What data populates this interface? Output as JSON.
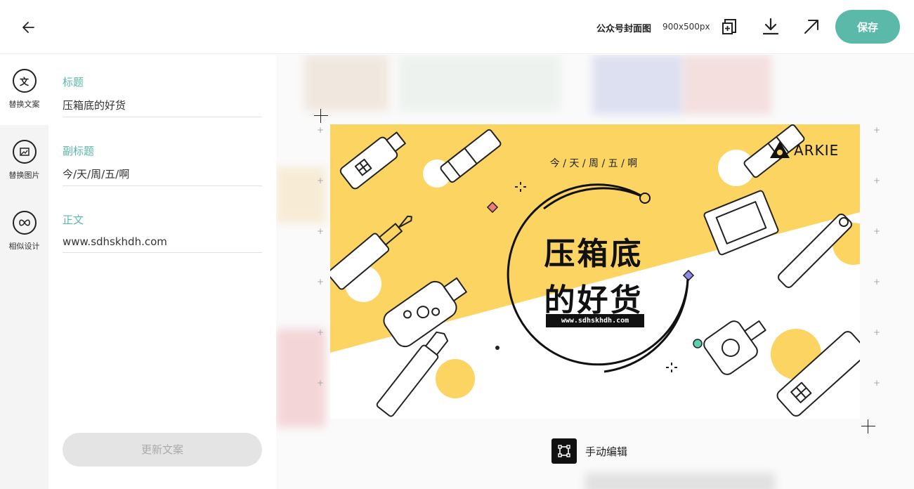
{
  "header": {
    "doc_title": "公众号封面图",
    "doc_size": "900x500px",
    "save_label": "保存"
  },
  "rail": {
    "items": [
      {
        "icon_text": "文",
        "label": "替换文案"
      },
      {
        "label": "替换图片"
      },
      {
        "label": "相似设计"
      }
    ]
  },
  "form": {
    "fields": [
      {
        "label": "标题",
        "value": "压箱底的好货"
      },
      {
        "label": "副标题",
        "value": "今/天/周/五/啊"
      },
      {
        "label": "正文",
        "value": "www.sdhskhdh.com"
      }
    ],
    "update_label": "更新文案"
  },
  "design": {
    "subtitle": "今 / 天 / 周 / 五 / 啊",
    "title_line1": "压箱底",
    "title_line2": "的好货",
    "url": "www.sdhskhdh.com",
    "brand": "ARKIE",
    "colors": {
      "yellow": "#fcd462",
      "teal": "#5ab9a8",
      "accent_pink": "#f07a7a",
      "accent_blue": "#8a8ae8",
      "accent_green": "#5ecfb0"
    }
  },
  "workspace": {
    "manual_edit_label": "手动编辑"
  }
}
